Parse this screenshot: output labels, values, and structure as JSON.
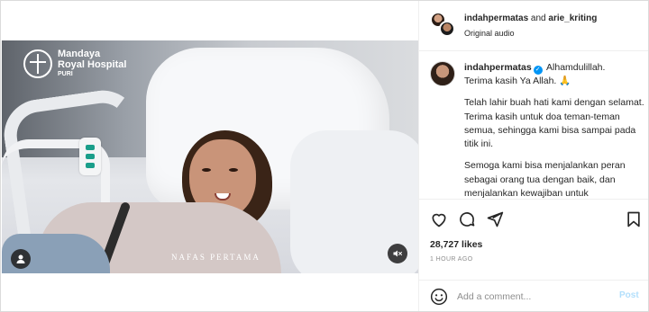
{
  "media": {
    "logo": {
      "line1": "Mandaya",
      "line2": "Royal Hospital",
      "line3": "PURI"
    },
    "overlay_caption": "NAFAS PERTAMA",
    "controls": {
      "user_tag_icon": "user-icon",
      "mute_icon": "speaker-muted-icon"
    }
  },
  "header": {
    "user1": "indahpermatas",
    "joiner": "and",
    "user2": "arie_kriting",
    "audio": "Original audio"
  },
  "comment": {
    "username": "indahpermatas",
    "verified": true,
    "line1": "Alhamdulillah.",
    "line2": "Terima kasih Ya Allah. 🙏",
    "para2": "Telah lahir buah hati kami dengan selamat. Terima kasih untuk doa teman-teman semua, sehingga kami bisa sampai pada titik ini.",
    "para3": "Semoga kami bisa menjalankan peran sebagai orang tua dengan baik, dan menjalankan kewajiban untuk membesarkan titipan Allah SWT ini"
  },
  "actions": {
    "icons": [
      "heart-icon",
      "comment-icon",
      "share-icon",
      "bookmark-icon"
    ],
    "likes": "28,727 likes",
    "timestamp": "1 HOUR AGO"
  },
  "add_comment": {
    "placeholder": "Add a comment...",
    "post_label": "Post"
  },
  "colors": {
    "verified": "#0095f6",
    "post_disabled": "#b2dffc",
    "border": "#dbdbdb"
  }
}
